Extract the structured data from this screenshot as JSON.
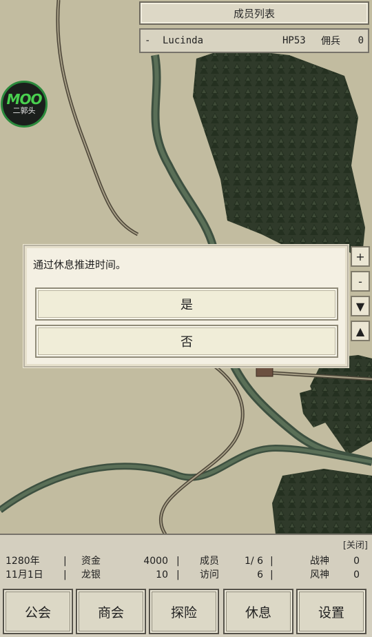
{
  "member_panel": {
    "title": "成员列表",
    "row": {
      "dash": "-",
      "name": "Lucinda",
      "hp": "HP53",
      "mercenary_label": "佣兵",
      "mercenary_value": "0"
    }
  },
  "logo": {
    "line1": "MOO",
    "line2": "二郭头"
  },
  "dialog": {
    "message": "通过休息推进时间。",
    "yes_label": "是",
    "no_label": "否"
  },
  "side_controls": {
    "zoom_in": "+",
    "zoom_out": "-",
    "down": "▼",
    "up": "▲"
  },
  "status": {
    "close_label": "[关闭]",
    "year": "1280年",
    "date": "11月1日",
    "funds_label": "资金",
    "funds_value": "4000",
    "dragon_silver_label": "龙银",
    "dragon_silver_value": "10",
    "members_label": "成员",
    "members_value": "1/ 6",
    "visits_label": "访问",
    "visits_value": "6",
    "war_god_label": "战神",
    "war_god_value": "0",
    "wind_god_label": "风神",
    "wind_god_value": "0",
    "sep": "|"
  },
  "tabs": [
    "公会",
    "商会",
    "探险",
    "休息",
    "设置"
  ]
}
